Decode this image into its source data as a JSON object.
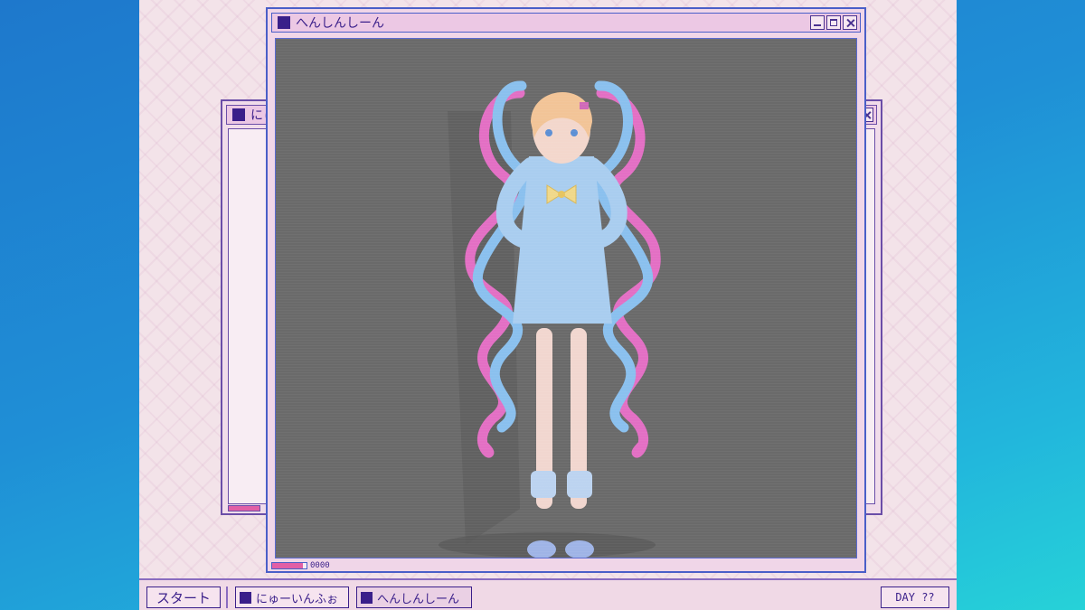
{
  "windows": {
    "back": {
      "title": "にゅ",
      "icon": "window-icon"
    },
    "main": {
      "title": "へんしんしーん",
      "icon": "window-icon",
      "status_counter": "0000",
      "progress": 0.9
    }
  },
  "scene": {
    "subject": "character-figure",
    "background_color": "#6a6a6a"
  },
  "taskbar": {
    "start_label": "スタート",
    "items": [
      {
        "label": "にゅーいんふぉ",
        "icon": "window-icon"
      },
      {
        "label": "へんしんしーん",
        "icon": "window-icon",
        "active": true
      }
    ],
    "day_label": "DAY ??"
  },
  "colors": {
    "accent_purple": "#3a1f8a",
    "pink": "#e15fa6",
    "blue_frame": "#4a5fc8",
    "desktop_pink": "#f3e3e9"
  }
}
